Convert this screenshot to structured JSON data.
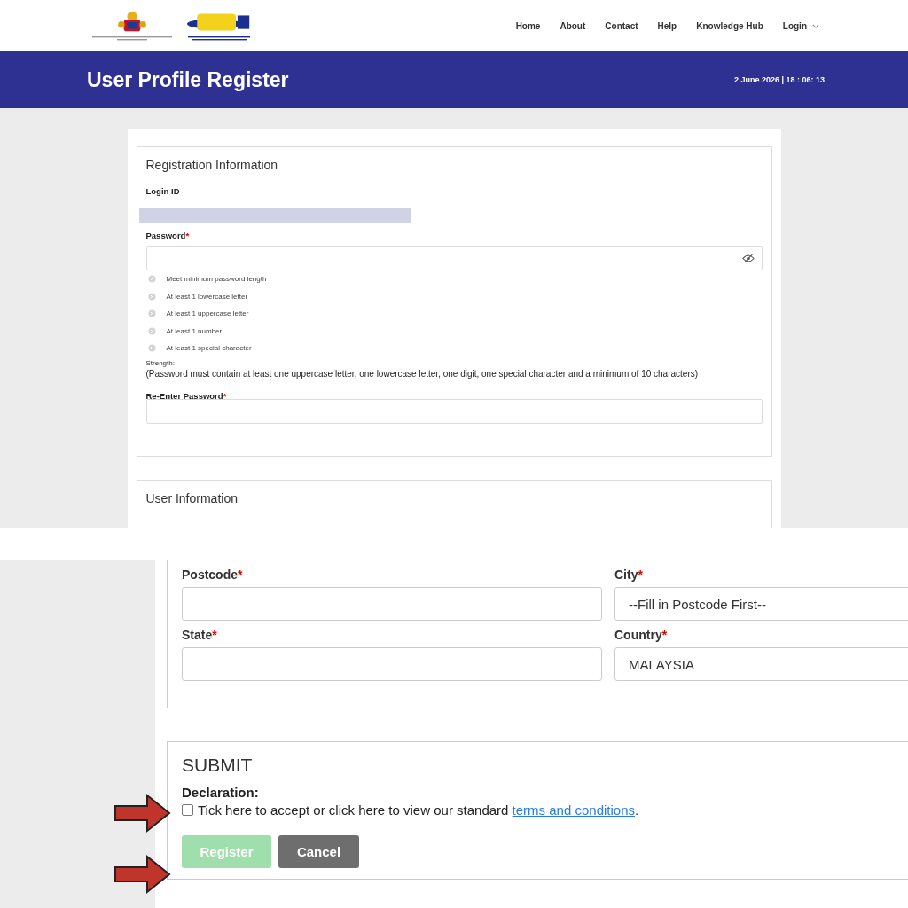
{
  "header": {
    "nav": [
      {
        "label": "Home",
        "dropdown": false
      },
      {
        "label": "About",
        "dropdown": false
      },
      {
        "label": "Contact",
        "dropdown": false
      },
      {
        "label": "Help",
        "dropdown": false
      },
      {
        "label": "Knowledge Hub",
        "dropdown": false
      },
      {
        "label": "Login",
        "dropdown": true
      }
    ]
  },
  "banner": {
    "title": "User Profile Register",
    "datetime": "2 June 2026 | 18 : 06: 13"
  },
  "registration": {
    "title": "Registration Information",
    "login_id_label": "Login ID",
    "password": {
      "label": "Password",
      "required_mark": "*"
    },
    "requirements": [
      {
        "text": "Meet minimum password length",
        "met": false
      },
      {
        "text": "At least 1 lowercase letter",
        "met": false
      },
      {
        "text": "At least 1 uppercase letter",
        "met": false
      },
      {
        "text": "At least 1 number",
        "met": false
      },
      {
        "text": "At least 1 special character",
        "met": false
      }
    ],
    "strength_label": "Strength:",
    "hint": "(Password must contain at least one uppercase letter, one lowercase letter, one digit, one special character and a minimum of 10 characters)",
    "reenter": {
      "label": "Re-Enter Password",
      "required_mark": "*"
    }
  },
  "user_information": {
    "title": "User Information"
  },
  "address": [
    {
      "label": "Postcode",
      "required_mark": "*"
    },
    {
      "label": "City",
      "required_mark": "*",
      "value": "--Fill in Postcode First--"
    },
    {
      "label": "State",
      "required_mark": "*"
    },
    {
      "label": "Country",
      "required_mark": "*",
      "value": "MALAYSIA"
    }
  ],
  "submit": {
    "title": "SUBMIT",
    "declaration_label": "Declaration:",
    "checked": false,
    "sentence": "Tick here to accept or click here to view our standard",
    "link": "terms and conditions",
    "after_link": ".",
    "buttons": [
      {
        "label": "Register",
        "kind": "primary",
        "disabled": true
      },
      {
        "label": "Cancel",
        "kind": "secondary",
        "disabled": false
      }
    ]
  }
}
